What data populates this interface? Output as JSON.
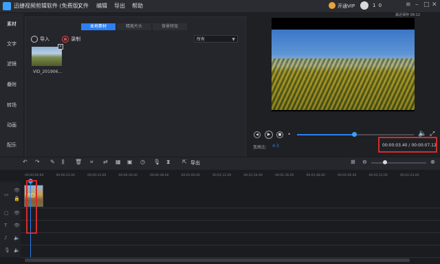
{
  "titlebar": {
    "app_title": "迅捷视频剪辑软件 (免费版)",
    "menus": [
      "文件",
      "编辑",
      "导出",
      "帮助"
    ],
    "vip_label": "开通VIP",
    "user_name": "1 0",
    "autosave": "最近保存 09:12"
  },
  "nav": {
    "items": [
      "素材",
      "文字",
      "滤镜",
      "叠附",
      "转场",
      "动画",
      "配乐"
    ],
    "active_index": 0
  },
  "media_panel": {
    "tabs": [
      "本地素材",
      "精美片头",
      "背景特效"
    ],
    "active_tab": 0,
    "import_label": "导入",
    "record_label": "录制",
    "filter_value": "所有",
    "items": [
      {
        "name": "VID_201906..."
      }
    ]
  },
  "preview": {
    "ratio_label": "宽高比:",
    "ratio_value": "4:3",
    "timecode": "00:00:03.40 / 00:00:07.12",
    "progress": 0.49
  },
  "toolbar": {
    "export_label": "导出",
    "zoom_level": 0.25
  },
  "timeline": {
    "ticks": [
      "00:00:00.00",
      "00:00:12.00",
      "00:00:24.00",
      "00:00:36.00",
      "00:00:48.00",
      "00:01:00.00",
      "00:01:12.00",
      "00:01:24.00",
      "00:01:36.00",
      "00:01:48.00",
      "00:02:00.00",
      "00:02:12.00",
      "00:02:24.00"
    ],
    "clip_label": "VID"
  },
  "colors": {
    "accent": "#2d7ff2",
    "highlight_border": "#d62b2b",
    "background": "#1f2024"
  }
}
